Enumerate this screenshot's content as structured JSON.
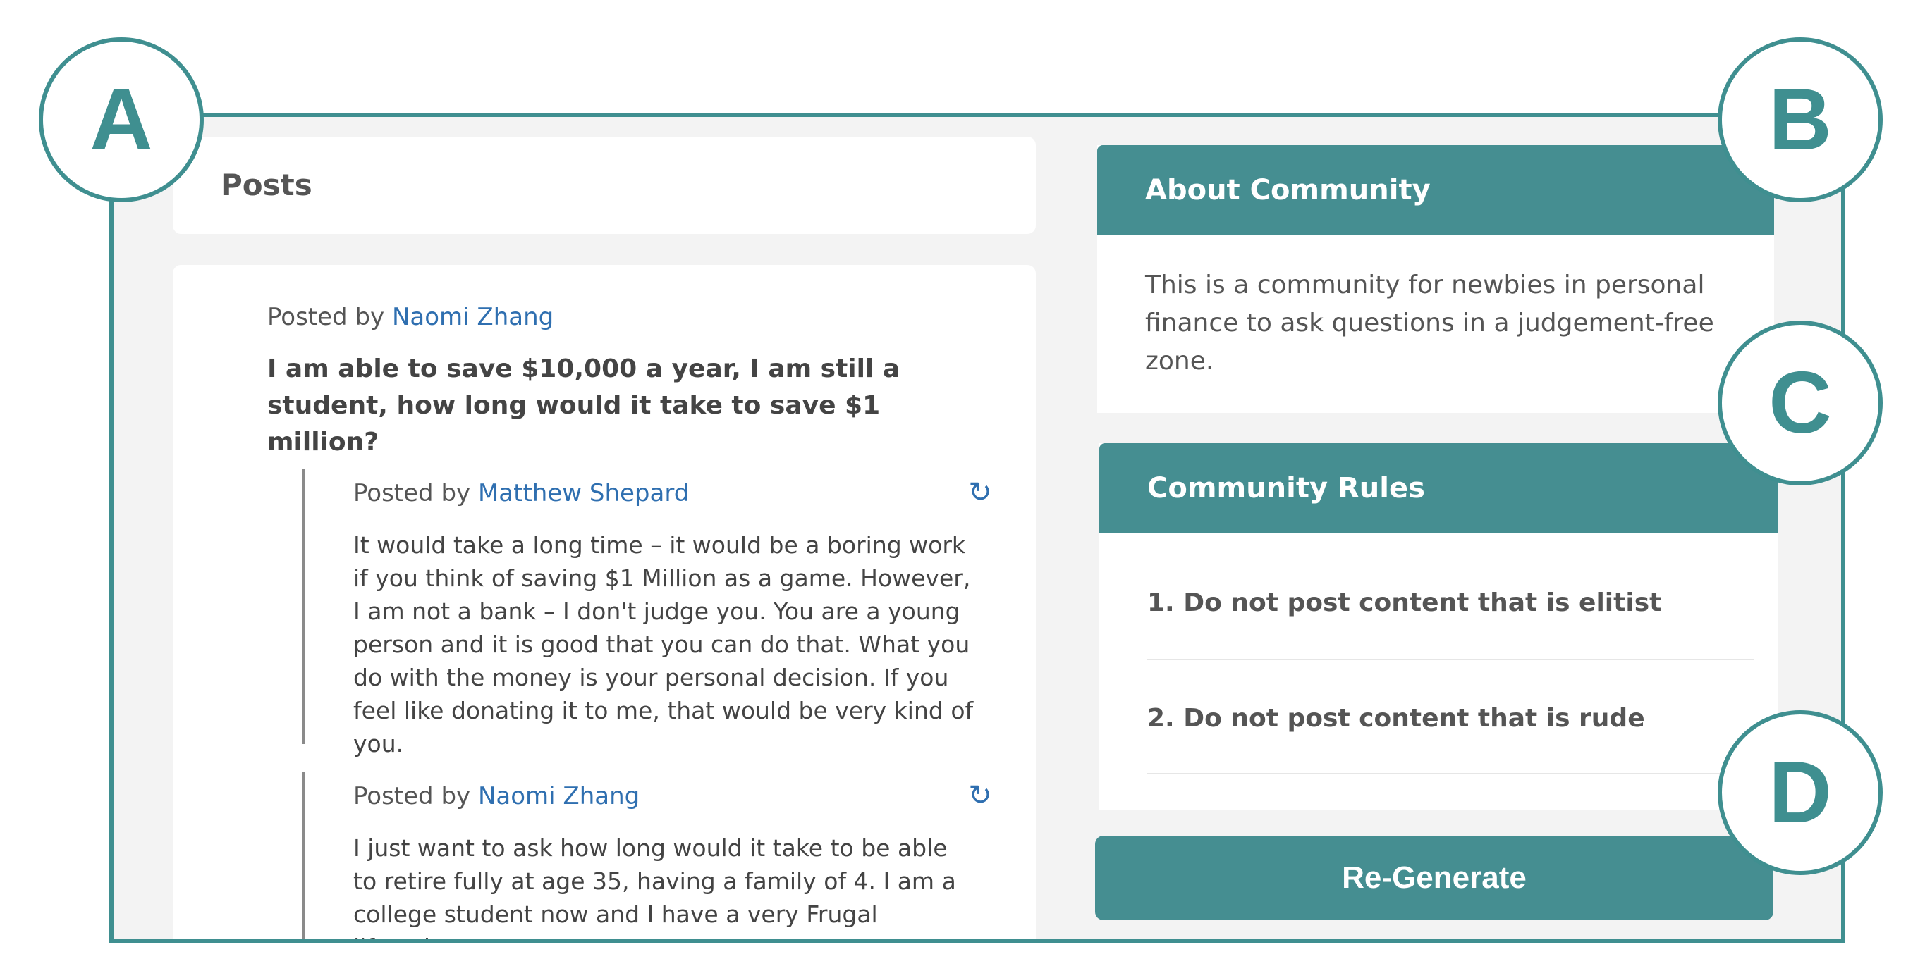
{
  "posts": {
    "header_title": "Posts",
    "post": {
      "byline_prefix": "Posted by",
      "author": "Naomi Zhang",
      "title": "I am able to save $10,000 a year, I am still a student, how long would it take to save $1 million?",
      "comments": [
        {
          "byline_prefix": "Posted by",
          "author": "Matthew Shepard",
          "text": "It would take a long time – it would be a boring work if you think of saving $1 Million as a game. However, I am not a bank – I don't judge you. You are a young person and it is good that you can do that. What you do with the money is your personal decision. If you feel like donating it to me, that would be very kind of you.",
          "icon": "refresh-icon"
        },
        {
          "byline_prefix": "Posted by",
          "author": "Naomi Zhang",
          "text": "I just want to ask how long would it take to be able to retire fully at age 35, having a family of 4. I am a college student now and I have a very Frugal lifestyle.",
          "icon": "refresh-icon"
        }
      ]
    }
  },
  "about": {
    "title": "About Community",
    "description": "This is a community for newbies in personal finance to ask questions in a judgement-free zone."
  },
  "rules": {
    "title": "Community Rules",
    "items": [
      "1. Do not post content that is elitist",
      "2. Do not post content that is rude"
    ]
  },
  "regenerate_label": "Re-Generate",
  "badges": [
    "A",
    "B",
    "C",
    "D"
  ],
  "colors": {
    "accent": "#458e91",
    "border": "#3f8f90",
    "link": "#2f6fb0",
    "background": "#f3f3f3"
  }
}
